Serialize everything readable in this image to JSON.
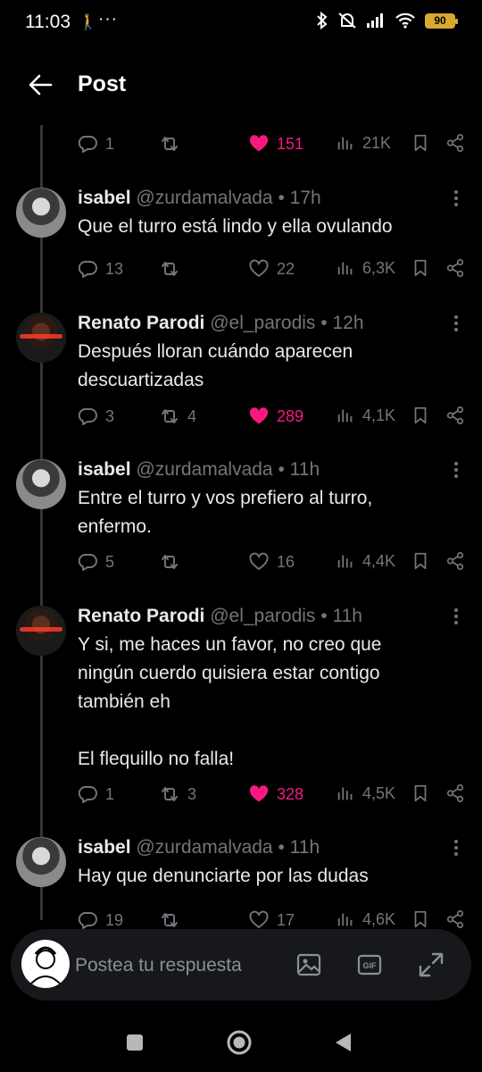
{
  "status_bar": {
    "time": "11:03",
    "battery": "90"
  },
  "header": {
    "title": "Post"
  },
  "top_actions": {
    "replies": "1",
    "retweets": "",
    "likes": "151",
    "views": "21K"
  },
  "replies": [
    {
      "name": "isabel",
      "handle": "@zurdamalvada",
      "dot": "•",
      "time": "17h",
      "text": "Que el turro está lindo y ella ovulando",
      "actions": {
        "replies": "13",
        "retweets": "",
        "likes": "22",
        "views": "6,3K"
      },
      "liked": false
    },
    {
      "name": "Renato Parodi",
      "handle": "@el_parodis",
      "dot": "•",
      "time": "12h",
      "text": "Después lloran cuándo aparecen descuartizadas",
      "actions": {
        "replies": "3",
        "retweets": "4",
        "likes": "289",
        "views": "4,1K"
      },
      "liked": true
    },
    {
      "name": "isabel",
      "handle": "@zurdamalvada",
      "dot": "•",
      "time": "11h",
      "text": "Entre el turro y vos prefiero al turro, enfermo.",
      "actions": {
        "replies": "5",
        "retweets": "",
        "likes": "16",
        "views": "4,4K"
      },
      "liked": false
    },
    {
      "name": "Renato Parodi",
      "handle": "@el_parodis",
      "dot": "•",
      "time": "11h",
      "text_lines": [
        "Y si, me haces un favor, no creo que ningún cuerdo quisiera estar contigo también eh",
        "El flequillo no falla!"
      ],
      "actions": {
        "replies": "1",
        "retweets": "3",
        "likes": "328",
        "views": "4,5K"
      },
      "liked": true
    },
    {
      "name": "isabel",
      "handle": "@zurdamalvada",
      "dot": "•",
      "time": "11h",
      "text": "Hay que denunciarte por las dudas",
      "actions": {
        "replies": "19",
        "retweets": "",
        "likes": "17",
        "views": "4,6K"
      },
      "liked": false
    }
  ],
  "composer": {
    "placeholder": "Postea tu respuesta"
  },
  "colors": {
    "like": "#f91880",
    "muted": "#71767b",
    "text": "#e7e9ea",
    "background": "#000000"
  },
  "icons": [
    "back-arrow-icon",
    "reply-icon",
    "retweet-icon",
    "heart-icon",
    "views-icon",
    "bookmark-icon",
    "share-icon",
    "more-icon",
    "image-icon",
    "gif-icon",
    "expand-icon"
  ]
}
